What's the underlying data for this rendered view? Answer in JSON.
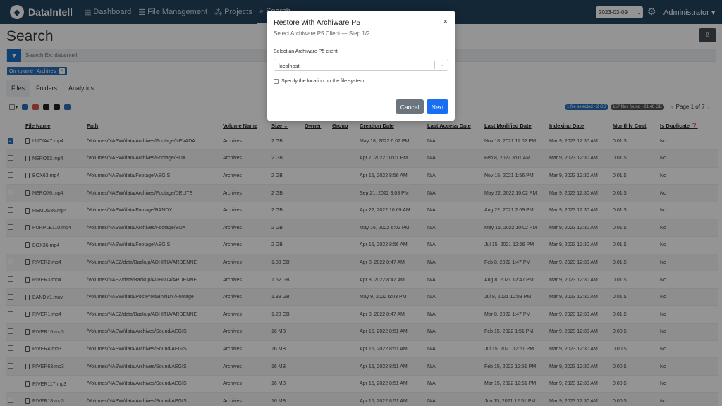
{
  "header": {
    "brand": "DataIntell",
    "nav": [
      {
        "label": "Dashboard",
        "icon": "chart-icon"
      },
      {
        "label": "File Management",
        "icon": "list-icon"
      },
      {
        "label": "Projects",
        "icon": "sitemap-icon"
      },
      {
        "label": "Search",
        "icon": "search-icon"
      }
    ],
    "date": "2023-03-09",
    "user": "Administrator"
  },
  "page": {
    "title": "Search",
    "search_placeholder": "Search Ex: dataintell",
    "filter_chip": "On volume : Archives",
    "tabs": [
      "Files",
      "Folders",
      "Analytics"
    ],
    "selected_badge": "1 file selected - 2 GB",
    "found_badge": "157 files found - 21.48 GB",
    "pager": "Page 1 of 7"
  },
  "table": {
    "columns": [
      "File Name",
      "Path",
      "Volume Name",
      "Size",
      "Owner",
      "Group",
      "Creation Date",
      "Last Access Date",
      "Last Modified Date",
      "Indexing Date",
      "Monthly Cost",
      "Is Duplicate"
    ],
    "rows": [
      {
        "checked": true,
        "name": "LUCIA47.mp4",
        "path": "/Volumes/NASW/data/Archives/Footage/NEVADA",
        "volume": "Archives",
        "size": "2 GB",
        "owner": "",
        "group": "",
        "created": "May 18, 2022 6:02 PM",
        "accessed": "N/A",
        "modified": "Nov 18, 2021 11:02 PM",
        "indexed": "Mar 9, 2023 12:30 AM",
        "cost": "0.01 $",
        "dup": "No"
      },
      {
        "checked": false,
        "name": "NERO53.mp4",
        "path": "/Volumes/NASW/data/Archives/Footage/BOX",
        "volume": "Archives",
        "size": "2 GB",
        "owner": "",
        "group": "",
        "created": "Apr 7, 2022 10:01 PM",
        "accessed": "N/A",
        "modified": "Feb 8, 2022 3:01 AM",
        "indexed": "Mar 9, 2023 12:30 AM",
        "cost": "0.01 $",
        "dup": "No"
      },
      {
        "checked": false,
        "name": "BOX63.mp4",
        "path": "/Volumes/NASW/data/Footage/AEGIS",
        "volume": "Archives",
        "size": "2 GB",
        "owner": "",
        "group": "",
        "created": "Apr 15, 2022 8:56 AM",
        "accessed": "N/A",
        "modified": "Nov 15, 2021 1:56 PM",
        "indexed": "Mar 9, 2023 12:30 AM",
        "cost": "0.01 $",
        "dup": "No"
      },
      {
        "checked": false,
        "name": "NERO76.mp4",
        "path": "/Volumes/NASW/data/Archives/Footage/DELITE",
        "volume": "Archives",
        "size": "2 GB",
        "owner": "",
        "group": "",
        "created": "Sep 21, 2022 3:03 PM",
        "accessed": "N/A",
        "modified": "May 22, 2022 10:02 PM",
        "indexed": "Mar 9, 2023 12:30 AM",
        "cost": "0.01 $",
        "dup": "No"
      },
      {
        "checked": false,
        "name": "REMUS86.mp4",
        "path": "/Volumes/NASW/data/Footage/BANDY",
        "volume": "Archives",
        "size": "2 GB",
        "owner": "",
        "group": "",
        "created": "Apr 22, 2022 10:09 AM",
        "accessed": "N/A",
        "modified": "Aug 22, 2021 2:09 PM",
        "indexed": "Mar 9, 2023 12:30 AM",
        "cost": "0.01 $",
        "dup": "No"
      },
      {
        "checked": false,
        "name": "PURPLE110.mp4",
        "path": "/Volumes/NASW/data/Archives/Footage/BOX",
        "volume": "Archives",
        "size": "2 GB",
        "owner": "",
        "group": "",
        "created": "May 16, 2022 6:02 PM",
        "accessed": "N/A",
        "modified": "May 16, 2022 10:02 PM",
        "indexed": "Mar 9, 2023 12:30 AM",
        "cost": "0.01 $",
        "dup": "No"
      },
      {
        "checked": false,
        "name": "BOX36.mp4",
        "path": "/Volumes/NASW/data/Footage/AEGIS",
        "volume": "Archives",
        "size": "2 GB",
        "owner": "",
        "group": "",
        "created": "Apr 15, 2022 8:56 AM",
        "accessed": "N/A",
        "modified": "Jul 15, 2021 12:56 PM",
        "indexed": "Mar 9, 2023 12:30 AM",
        "cost": "0.01 $",
        "dup": "No"
      },
      {
        "checked": false,
        "name": "RIVER2.mp4",
        "path": "/Volumes/NASZ/data/Backup/ADHITIA/ARDENNE",
        "volume": "Archives",
        "size": "1.83 GB",
        "owner": "",
        "group": "",
        "created": "Apr 8, 2022 8:47 AM",
        "accessed": "N/A",
        "modified": "Feb 8, 2022 1:47 PM",
        "indexed": "Mar 9, 2023 12:30 AM",
        "cost": "0.01 $",
        "dup": "No"
      },
      {
        "checked": false,
        "name": "RIVER3.mp4",
        "path": "/Volumes/NASZ/data/Backup/ADHITIA/ARDENNE",
        "volume": "Archives",
        "size": "1.62 GB",
        "owner": "",
        "group": "",
        "created": "Apr 8, 2022 8:47 AM",
        "accessed": "N/A",
        "modified": "Aug 8, 2021 12:47 PM",
        "indexed": "Mar 9, 2023 12:30 AM",
        "cost": "0.01 $",
        "dup": "No"
      },
      {
        "checked": false,
        "name": "BANDY1.mov",
        "path": "/Volumes/NASW/data/PostProd/BANDY/Footage",
        "volume": "Archives",
        "size": "1.39 GB",
        "owner": "",
        "group": "",
        "created": "May 9, 2022 6:03 PM",
        "accessed": "N/A",
        "modified": "Jul 9, 2021 10:03 PM",
        "indexed": "Mar 9, 2023 12:30 AM",
        "cost": "0.01 $",
        "dup": "No"
      },
      {
        "checked": false,
        "name": "RIVER1.mp4",
        "path": "/Volumes/NASZ/data/Backup/ADHITIA/ARDENNE",
        "volume": "Archives",
        "size": "1.23 GB",
        "owner": "",
        "group": "",
        "created": "Apr 8, 2022 8:47 AM",
        "accessed": "N/A",
        "modified": "Mar 8, 2022 1:47 PM",
        "indexed": "Mar 9, 2023 12:30 AM",
        "cost": "0.01 $",
        "dup": "No"
      },
      {
        "checked": false,
        "name": "RIVER16.mp3",
        "path": "/Volumes/NASW/data/Archives/Sound/AEGIS",
        "volume": "Archives",
        "size": "16 MB",
        "owner": "",
        "group": "",
        "created": "Apr 15, 2022 8:51 AM",
        "accessed": "N/A",
        "modified": "Feb 15, 2022 1:51 PM",
        "indexed": "Mar 9, 2023 12:30 AM",
        "cost": "0.00 $",
        "dup": "No"
      },
      {
        "checked": false,
        "name": "RIVER4.mp3",
        "path": "/Volumes/NASW/data/Archives/Sound/AEGIS",
        "volume": "Archives",
        "size": "16 MB",
        "owner": "",
        "group": "",
        "created": "Apr 15, 2022 8:51 AM",
        "accessed": "N/A",
        "modified": "Jul 15, 2021 12:51 PM",
        "indexed": "Mar 9, 2023 12:30 AM",
        "cost": "0.00 $",
        "dup": "No"
      },
      {
        "checked": false,
        "name": "RIVER63.mp3",
        "path": "/Volumes/NASW/data/Archives/Sound/AEGIS",
        "volume": "Archives",
        "size": "16 MB",
        "owner": "",
        "group": "",
        "created": "Apr 15, 2022 8:51 AM",
        "accessed": "N/A",
        "modified": "Feb 15, 2022 12:51 PM",
        "indexed": "Mar 9, 2023 12:30 AM",
        "cost": "0.00 $",
        "dup": "No"
      },
      {
        "checked": false,
        "name": "RIVER117.mp3",
        "path": "/Volumes/NASW/data/Archives/Sound/AEGIS",
        "volume": "Archives",
        "size": "16 MB",
        "owner": "",
        "group": "",
        "created": "Apr 15, 2022 8:51 AM",
        "accessed": "N/A",
        "modified": "Mar 15, 2022 12:51 PM",
        "indexed": "Mar 9, 2023 12:30 AM",
        "cost": "0.00 $",
        "dup": "No"
      },
      {
        "checked": false,
        "name": "RIVER18.mp3",
        "path": "/Volumes/NASW/data/Archives/Sound/AEGIS",
        "volume": "Archives",
        "size": "16 MB",
        "owner": "",
        "group": "",
        "created": "Apr 15, 2022 8:51 AM",
        "accessed": "N/A",
        "modified": "Jun 15, 2021 12:51 PM",
        "indexed": "Mar 9, 2023 12:30 AM",
        "cost": "0.00 $",
        "dup": "No"
      }
    ]
  },
  "modal": {
    "title": "Restore with Archiware P5",
    "subtitle": "Select Archiware P5 Client — Step 1/2",
    "client_label": "Select an Archiware P5 client",
    "client_value": "localhost",
    "location_label": "Specify the location on the file system",
    "cancel": "Cancel",
    "next": "Next"
  },
  "colors": {
    "topbar": "#24445f",
    "primary": "#1a6ef2",
    "chip": "#2a6ebb",
    "cancel": "#6c757d"
  }
}
